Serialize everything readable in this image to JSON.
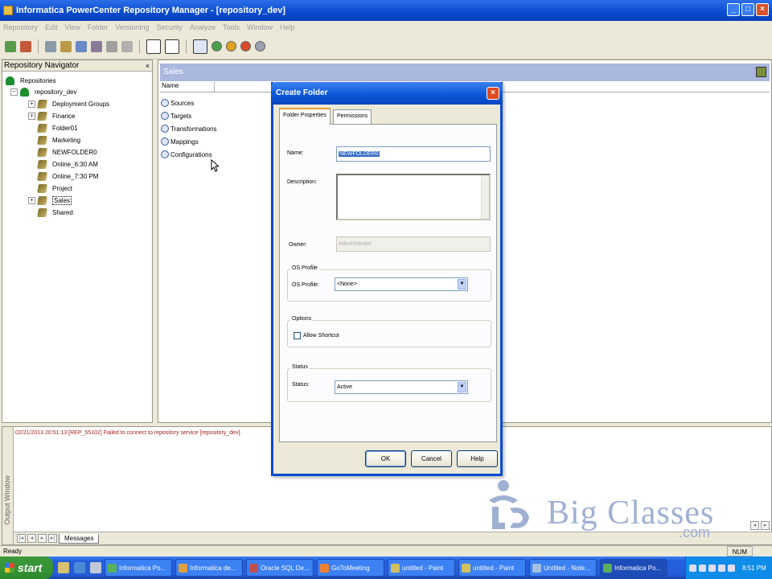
{
  "window": {
    "title": "Informatica PowerCenter Repository Manager - [repository_dev]",
    "min": "_",
    "max": "□",
    "close": "×"
  },
  "menu": [
    "Repository",
    "Edit",
    "View",
    "Folder",
    "Versioning",
    "Security",
    "Analyze",
    "Tools",
    "Window",
    "Help"
  ],
  "navigator": {
    "title": "Repository Navigator",
    "close": "×",
    "root": "Repositories",
    "repo": "repository_dev",
    "folders": [
      {
        "label": "Deployment Groups",
        "expandable": true
      },
      {
        "label": "Finance",
        "expandable": true
      },
      {
        "label": "Folder01",
        "expandable": false
      },
      {
        "label": "Marketing",
        "expandable": false
      },
      {
        "label": "NEWFOLDER0",
        "expandable": false
      },
      {
        "label": "Online_6:30 AM",
        "expandable": false
      },
      {
        "label": "Online_7:30 PM",
        "expandable": false
      },
      {
        "label": "Project",
        "expandable": false
      },
      {
        "label": "Sales",
        "expandable": true,
        "selected": true
      },
      {
        "label": "Shared",
        "expandable": false
      }
    ]
  },
  "rightpane": {
    "title": "Sales",
    "column_name": "Name",
    "items": [
      "Sources",
      "Targets",
      "Transformations",
      "Mappings",
      "Configurations"
    ]
  },
  "output": {
    "side_label": "Output Window",
    "message": "02/21/2013 20:51:13 [REP_55102] Failed to connect to repository service [repository_dev].",
    "tab": "Messages"
  },
  "status": {
    "left": "Ready",
    "num": "NUM"
  },
  "dialog": {
    "title": "Create Folder",
    "close": "×",
    "tabs": [
      "Folder Properties",
      "Permissions"
    ],
    "name_label": "Name:",
    "name_value": "NEWFOLDER0",
    "description_label": "Description:",
    "description_value": "",
    "owner_label": "Owner:",
    "owner_value": "Administrator",
    "os_group": "OS Profile",
    "os_label": "OS Profile:",
    "os_value": "<None>",
    "options_group": "Options",
    "allow_shortcut": "Allow Shortcut",
    "status_group": "Status",
    "status_label": "Status:",
    "status_value": "Active",
    "ok": "OK",
    "cancel": "Cancel",
    "help": "Help"
  },
  "taskbar": {
    "start": "start",
    "tasks": [
      "Informatica Po...",
      "Informatica de...",
      "Oracle SQL De...",
      "GoToMeeting",
      "untitled - Paint",
      "untitled - Paint",
      "Untitled - Note...",
      "Informatica Po..."
    ],
    "clock": "8:51 PM"
  },
  "watermark": {
    "brand": "Big Classes",
    "domain": ".com"
  },
  "colors": {
    "titlebar": "#0a4bd0",
    "error_text": "#a0241e",
    "taskbar": "#245edb",
    "start": "#2f8a2f",
    "watermark": "#9fb0d2"
  }
}
